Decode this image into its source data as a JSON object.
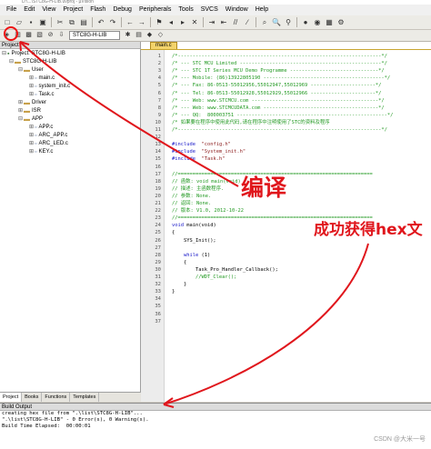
{
  "window": {
    "title": "D:\\...\\STC8G-H-LIB.uvproj - µVision"
  },
  "menu": [
    "File",
    "Edit",
    "View",
    "Project",
    "Flash",
    "Debug",
    "Peripherals",
    "Tools",
    "SVCS",
    "Window",
    "Help"
  ],
  "toolbar": {
    "target": "STC8G-H-LIB"
  },
  "project_panel": {
    "title": "Project",
    "tree": [
      {
        "label": "Project: STC8G-H-LIB",
        "level": 0
      },
      {
        "label": "STC8G-H-LIB",
        "level": 1
      },
      {
        "label": "User",
        "level": 2
      },
      {
        "label": "main.c",
        "level": 3
      },
      {
        "label": "system_init.c",
        "level": 3
      },
      {
        "label": "Task.c",
        "level": 3
      },
      {
        "label": "Driver",
        "level": 2
      },
      {
        "label": "ISR",
        "level": 2
      },
      {
        "label": "APP",
        "level": 2
      },
      {
        "label": "APP.c",
        "level": 3
      },
      {
        "label": "ARC_APP.c",
        "level": 3
      },
      {
        "label": "ARC_LED.c",
        "level": 3
      },
      {
        "label": "KEY.c",
        "level": 3
      }
    ],
    "tabs": [
      "Project",
      "Books",
      "Functions",
      "Templates"
    ]
  },
  "editor": {
    "file_tab": "main.c",
    "line_count": 37,
    "lines": [
      {
        "t": "/*---------------------------------------------------------------------*/",
        "k": "c"
      },
      {
        "t": "/* --- STC MCU Limited ------------------------------------------------*/",
        "k": "c"
      },
      {
        "t": "/* --- STC 1T Series MCU Demo Programme ------------------------------*/",
        "k": "c"
      },
      {
        "t": "/* --- Mobile: (86)13922805190 -----------------------------------------*/",
        "k": "c"
      },
      {
        "t": "/* --- Fax: 86-0513-55012956,55012947,55012969 ----------------------*/",
        "k": "c"
      },
      {
        "t": "/* --- Tel: 86-0513-55012928,55012929,55012966 ----------------------*/",
        "k": "c"
      },
      {
        "t": "/* --- Web: www.STCMCU.com -------------------------------------------*/",
        "k": "c"
      },
      {
        "t": "/* --- Web: www.STCMCUDATA.com ---------------------------------------*/",
        "k": "c"
      },
      {
        "t": "/* --- QQ:  800003751 ---------------------------------------------------*/",
        "k": "c"
      },
      {
        "t": "/* 如果要在程序中使用此代码,请在程序中注明使用了STC的资料及程序",
        "k": "c"
      },
      {
        "t": "/*---------------------------------------------------------------------*/",
        "k": "c"
      },
      {
        "t": "",
        "k": "p"
      },
      {
        "t": "#include  \"config.h\"",
        "k": "i"
      },
      {
        "t": "#include  \"System_init.h\"",
        "k": "i"
      },
      {
        "t": "#include  \"Task.h\"",
        "k": "i"
      },
      {
        "t": "",
        "k": "p"
      },
      {
        "t": "//==================================================================",
        "k": "c"
      },
      {
        "t": "// 函数: void main(void)",
        "k": "c"
      },
      {
        "t": "// 描述: 主函数程序.",
        "k": "c"
      },
      {
        "t": "// 参数: None.",
        "k": "c"
      },
      {
        "t": "// 返回: None.",
        "k": "c"
      },
      {
        "t": "// 版本: V1.0, 2012-10-22",
        "k": "c"
      },
      {
        "t": "//==================================================================",
        "k": "c"
      },
      {
        "t": "void main(void)",
        "k": "k"
      },
      {
        "t": "{",
        "k": "p"
      },
      {
        "t": "    SYS_Init();",
        "k": "p"
      },
      {
        "t": "",
        "k": "p"
      },
      {
        "t": "    while (1)",
        "k": "k"
      },
      {
        "t": "    {",
        "k": "p"
      },
      {
        "t": "        Task_Pro_Handler_Callback();",
        "k": "p"
      },
      {
        "t": "        //WDT_Clear();",
        "k": "c"
      },
      {
        "t": "    }",
        "k": "p"
      },
      {
        "t": "}",
        "k": "p"
      },
      {
        "t": "",
        "k": "p"
      },
      {
        "t": "",
        "k": "p"
      },
      {
        "t": "",
        "k": "p"
      },
      {
        "t": "",
        "k": "p"
      }
    ]
  },
  "build_output": {
    "title": "Build Output",
    "lines": [
      "creating hex file from \".\\list\\STC8G-H-LIB\"...",
      "\".\\list\\STC8G-H-LIB\" - 0 Error(s), 0 Warning(s).",
      "Build Time Elapsed:  00:00:01"
    ]
  },
  "annotations": {
    "compile": "编译",
    "hex_success": "成功获得hex文",
    "color": "#e0161c"
  },
  "watermark": "CSDN @大米一号"
}
